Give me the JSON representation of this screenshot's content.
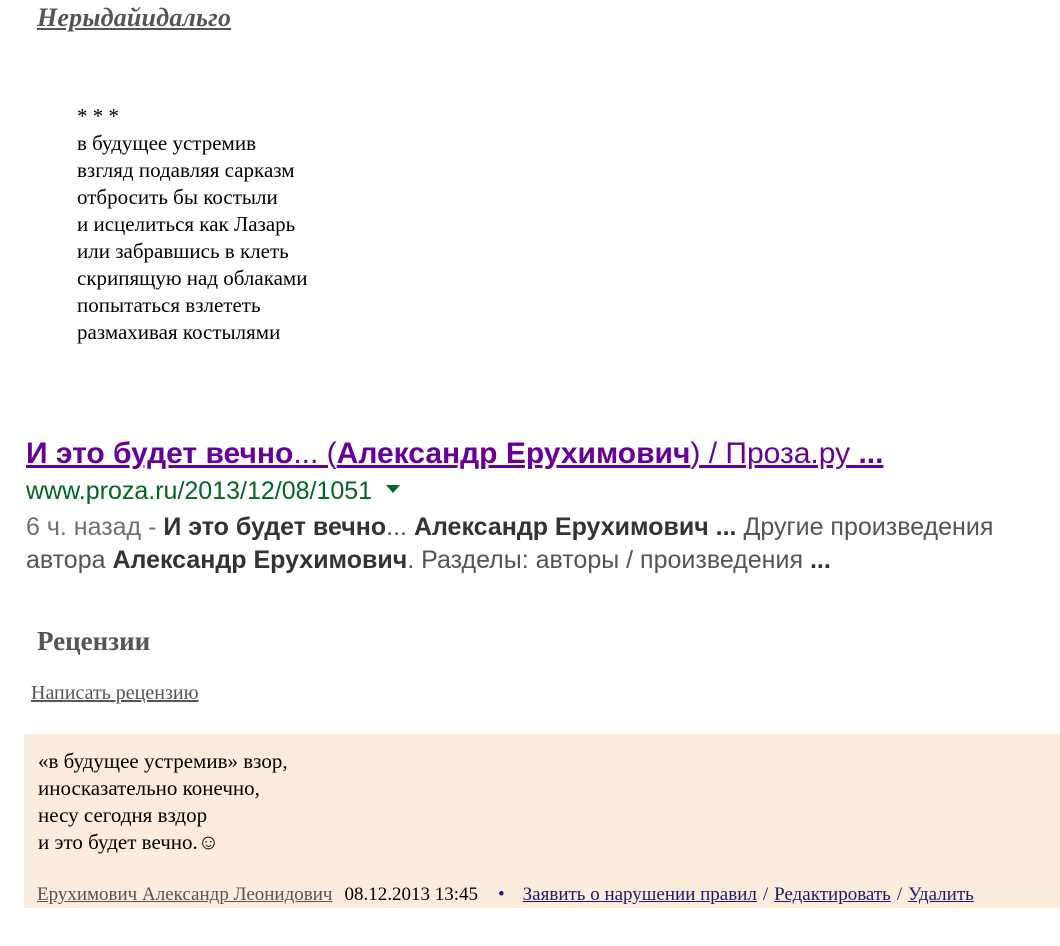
{
  "author": {
    "title": "Нерыдайидальго"
  },
  "poem": {
    "separator": "* * *",
    "lines": [
      "в будущее устремив",
      "взгляд подавляя сарказм",
      "отбросить бы костыли",
      "и исцелиться как Лазарь",
      "или забравшись в клеть",
      "скрипящую над облаками",
      "попытаться взлететь",
      "размахивая костылями"
    ]
  },
  "search_result": {
    "title_parts": {
      "p1": "И это будет вечно",
      "p2": "... (",
      "p3": "Александр Ерухимович",
      "p4": ") / Проза.ру ",
      "p5": "..."
    },
    "url": "www.proza.ru/2013/12/08/1051",
    "snippet": {
      "age": "6 ч. назад - ",
      "b1": "И это будет вечно",
      "t1": "... ",
      "b2": "Александр Ерухимович ...",
      "t2": " Другие произведения автора ",
      "b3": "Александр Ерухимович",
      "t3": ". Разделы: авторы / произведения ",
      "b4": "..."
    }
  },
  "reviews": {
    "heading": "Рецензии",
    "write_link": "Написать рецензию",
    "items": [
      {
        "lines": [
          "«в будущее устремив» взор,",
          "иносказательно конечно,",
          "несу сегодня вздор",
          "и это будет вечно.☺"
        ],
        "author": "Ерухимович Александр Леонидович",
        "date": "08.12.2013 13:45",
        "bullet": "•",
        "actions": {
          "report": "Заявить о нарушении правил",
          "edit": "Редактировать",
          "delete": "Удалить",
          "separator": "/"
        }
      }
    ]
  },
  "colors": {
    "visited_link": "#660099",
    "url_green": "#006621",
    "review_bg": "#fdebdb",
    "action_link": "#1a1a6e"
  }
}
